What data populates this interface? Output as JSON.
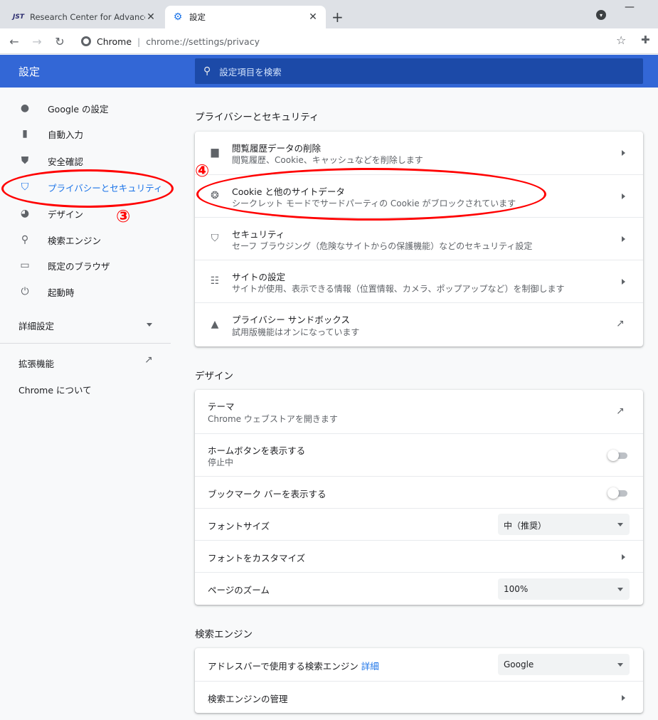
{
  "tabs": [
    {
      "title": "Research Center for Advanced Co",
      "favicon": "JST",
      "close": "✕"
    },
    {
      "title": "設定",
      "close": "✕"
    }
  ],
  "toolbar": {
    "url_chrome": "Chrome",
    "url_sep": "|",
    "url_path": "chrome://settings/privacy"
  },
  "header": {
    "title": "設定",
    "search_placeholder": "設定項目を検索"
  },
  "sidebar": {
    "items": [
      {
        "label": "Google の設定",
        "icon": "person-icon"
      },
      {
        "label": "自動入力",
        "icon": "clipboard-icon"
      },
      {
        "label": "安全確認",
        "icon": "shield-check-icon"
      },
      {
        "label": "プライバシーとセキュリティ",
        "icon": "shield-icon",
        "selected": true
      },
      {
        "label": "デザイン",
        "icon": "palette-icon"
      },
      {
        "label": "検索エンジン",
        "icon": "search-icon"
      },
      {
        "label": "既定のブラウザ",
        "icon": "browser-icon"
      },
      {
        "label": "起動時",
        "icon": "power-icon"
      }
    ],
    "advanced": "詳細設定",
    "extensions": "拡張機能",
    "about": "Chrome について"
  },
  "privacy": {
    "section_title": "プライバシーとセキュリティ",
    "rows": [
      {
        "title": "閲覧履歴データの削除",
        "subtitle": "閲覧履歴、Cookie、キャッシュなどを削除します",
        "icon": "trash-icon"
      },
      {
        "title": "Cookie と他のサイトデータ",
        "subtitle": "シークレット モードでサードパーティの Cookie がブロックされています",
        "icon": "cookie-icon"
      },
      {
        "title": "セキュリティ",
        "subtitle": "セーフ ブラウジング（危険なサイトからの保護機能）などのセキュリティ設定",
        "icon": "shield-icon"
      },
      {
        "title": "サイトの設定",
        "subtitle": "サイトが使用、表示できる情報（位置情報、カメラ、ポップアップなど）を制御します",
        "icon": "tune-icon"
      },
      {
        "title": "プライバシー サンドボックス",
        "subtitle": "試用版機能はオンになっています",
        "icon": "flask-icon"
      }
    ]
  },
  "design": {
    "section_title": "デザイン",
    "theme_title": "テーマ",
    "theme_sub": "Chrome ウェブストアを開きます",
    "home_title": "ホームボタンを表示する",
    "home_sub": "停止中",
    "home_on": false,
    "bookmarks_title": "ブックマーク バーを表示する",
    "bookmarks_on": false,
    "font_size_label": "フォントサイズ",
    "font_size_value": "中（推奨）",
    "customize_fonts": "フォントをカスタマイズ",
    "zoom_label": "ページのズーム",
    "zoom_value": "100%"
  },
  "search_engine": {
    "section_title": "検索エンジン",
    "addressbar_label": "アドレスバーで使用する検索エンジン",
    "addressbar_link": "詳細",
    "engine_value": "Google",
    "manage": "検索エンジンの管理"
  },
  "annotations": {
    "num3": "③",
    "num4": "④",
    "color": "#ff0000"
  },
  "colors": {
    "header": "#3367d6",
    "accent": "#1a73e8",
    "annotation": "#ff0000"
  }
}
